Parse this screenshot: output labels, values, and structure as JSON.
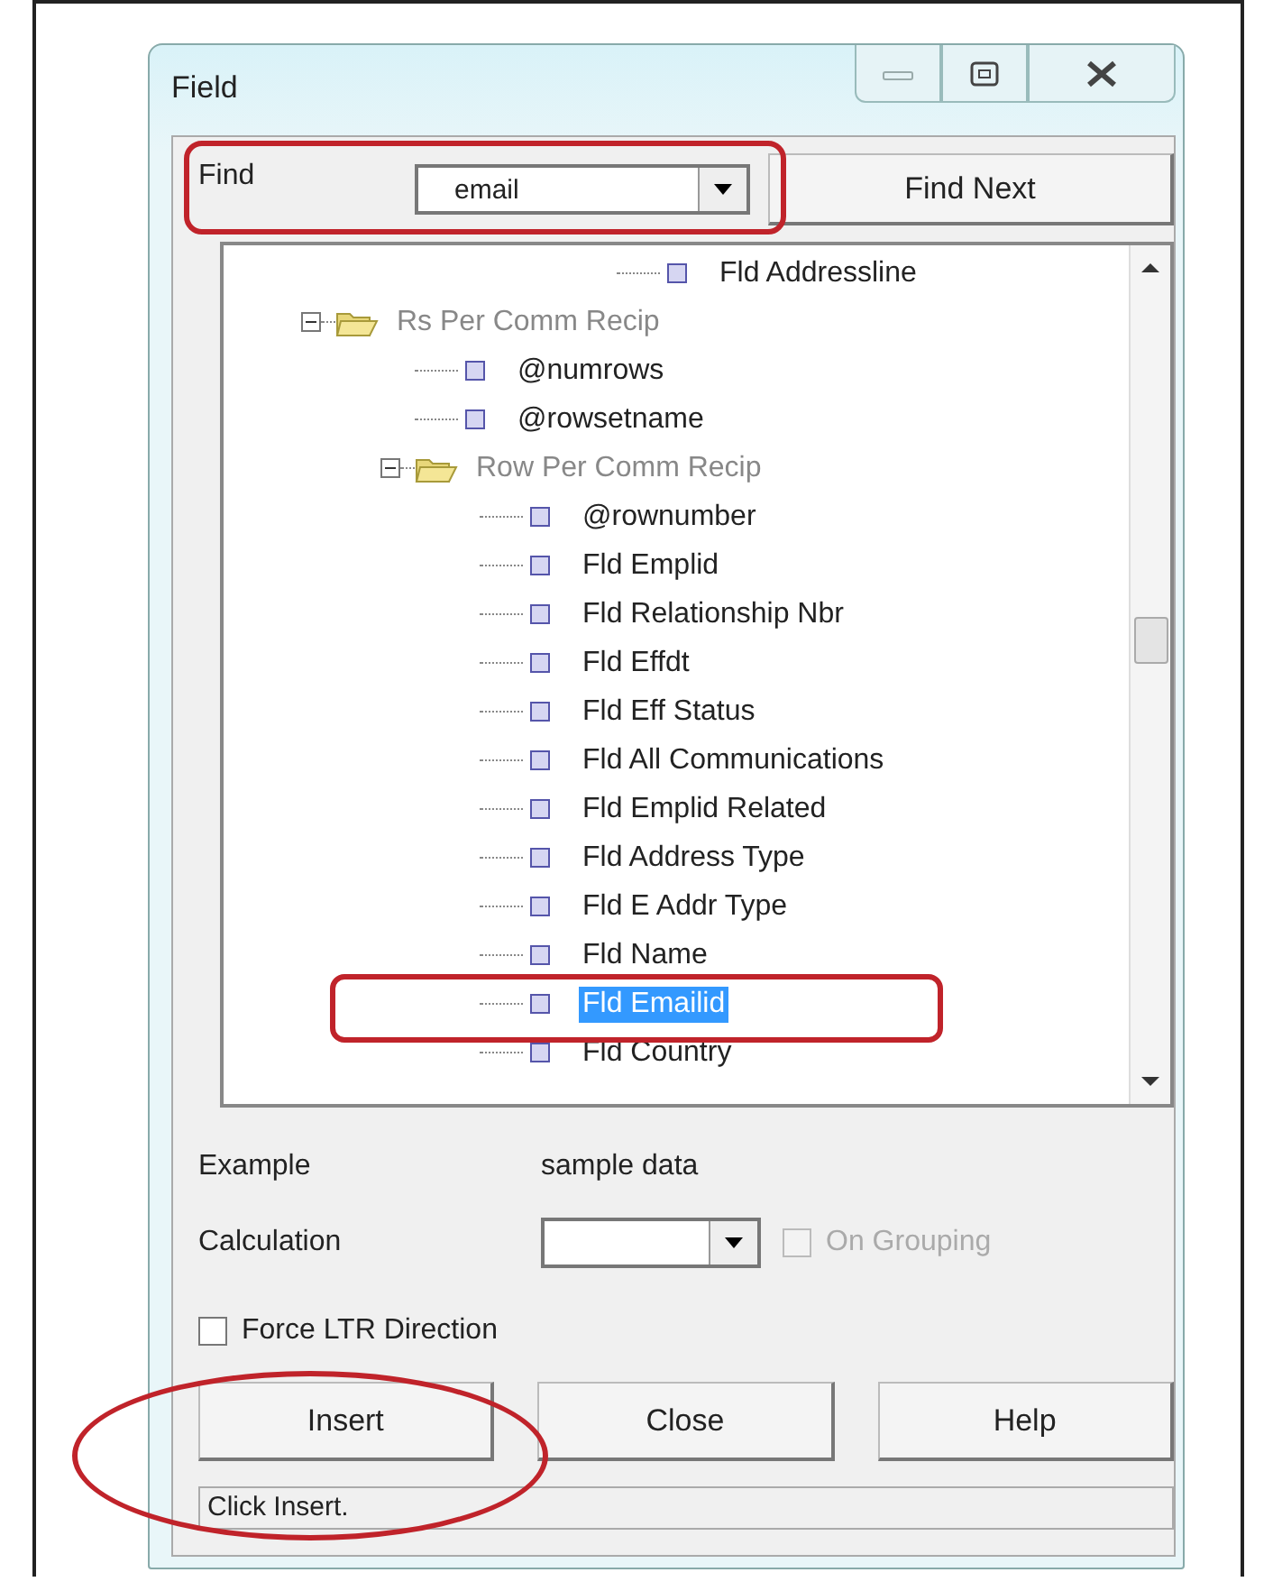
{
  "window": {
    "title": "Field"
  },
  "find": {
    "label": "Find",
    "value": "email",
    "button": "Find Next"
  },
  "tree": {
    "partial_item": {
      "label": "Fld Addressline",
      "selected": false
    },
    "items": [
      {
        "label": "Rs Per Comm Recip",
        "kind": "folder",
        "expanded": true,
        "selected": false,
        "children": [
          {
            "label": "@numrows",
            "kind": "field",
            "selected": false
          },
          {
            "label": "@rowsetname",
            "kind": "field",
            "selected": false
          },
          {
            "label": "Row Per Comm Recip",
            "kind": "folder",
            "expanded": true,
            "selected": false,
            "children": [
              {
                "label": "@rownumber",
                "kind": "field",
                "selected": false
              },
              {
                "label": "Fld Emplid",
                "kind": "field",
                "selected": false
              },
              {
                "label": "Fld Relationship Nbr",
                "kind": "field",
                "selected": false
              },
              {
                "label": "Fld Effdt",
                "kind": "field",
                "selected": false
              },
              {
                "label": "Fld Eff Status",
                "kind": "field",
                "selected": false
              },
              {
                "label": "Fld All Communications",
                "kind": "field",
                "selected": false
              },
              {
                "label": "Fld Emplid Related",
                "kind": "field",
                "selected": false
              },
              {
                "label": "Fld Address Type",
                "kind": "field",
                "selected": false
              },
              {
                "label": "Fld E Addr Type",
                "kind": "field",
                "selected": false
              },
              {
                "label": "Fld Name",
                "kind": "field",
                "selected": false
              },
              {
                "label": "Fld Emailid",
                "kind": "field",
                "selected": true
              },
              {
                "label": "Fld Country",
                "kind": "field",
                "selected": false
              }
            ]
          }
        ]
      }
    ]
  },
  "example": {
    "label": "Example",
    "value": "sample data"
  },
  "calculation": {
    "label": "Calculation",
    "grouping": {
      "label": "On Grouping",
      "checked": false,
      "disabled": true
    }
  },
  "force_ltr": {
    "label": "Force LTR Direction",
    "checked": false,
    "disabled": false
  },
  "buttons": [
    "Insert",
    "Close",
    "Help"
  ],
  "status_bar": "Click Insert."
}
